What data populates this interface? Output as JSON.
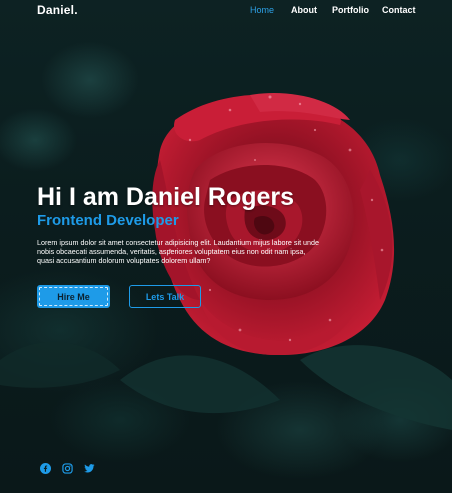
{
  "nav": {
    "logo": "Daniel",
    "logo_dot": ".",
    "items": [
      {
        "label": "Home",
        "active": true
      },
      {
        "label": "About",
        "active": false
      },
      {
        "label": "Portfolio",
        "active": false
      },
      {
        "label": "Contact",
        "active": false
      }
    ]
  },
  "hero": {
    "title": "Hi I am Daniel Rogers",
    "subtitle": "Frontend Developer",
    "description": "Lorem ipsum dolor sit amet consectetur adipisicing elit. Laudantium mijus labore sit unde nobis obcaecati assumenda, veritatis, asperiores voluptatem eius non odit nam ipsa, quasi accusantium dolorum voluptates dolorem ullam?",
    "hire_label": "Hire Me",
    "talk_label": "Lets Talk"
  },
  "social": {
    "icons": [
      "facebook-icon",
      "instagram-icon",
      "twitter-icon"
    ]
  },
  "colors": {
    "accent": "#1e9be8",
    "background": "#0b1d1e",
    "rose": "#b0172b"
  }
}
